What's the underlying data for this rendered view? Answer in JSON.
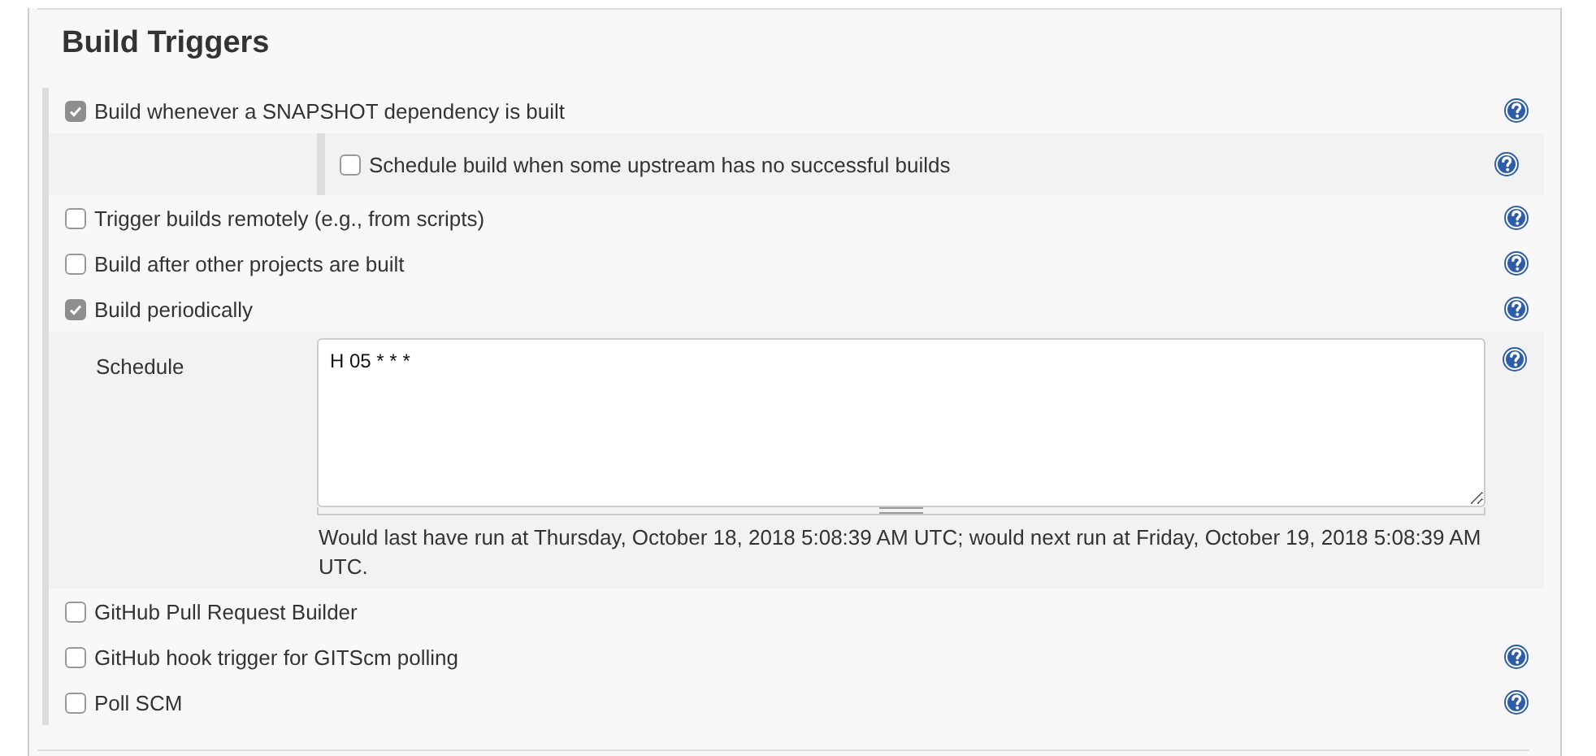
{
  "section": {
    "title": "Build Triggers"
  },
  "triggers": [
    {
      "label": "Build whenever a SNAPSHOT dependency is built",
      "checked": true,
      "help": true,
      "children": [
        {
          "label": "Schedule build when some upstream has no successful builds",
          "checked": false,
          "help": true
        }
      ]
    },
    {
      "label": "Trigger builds remotely (e.g., from scripts)",
      "checked": false,
      "help": true
    },
    {
      "label": "Build after other projects are built",
      "checked": false,
      "help": true
    },
    {
      "label": "Build periodically",
      "checked": true,
      "help": true,
      "schedule": {
        "label": "Schedule",
        "value": "H 05 * * *",
        "help": true,
        "description": "Would last have run at Thursday, October 18, 2018 5:08:39 AM UTC; would next run at Friday, October 19, 2018 5:08:39 AM UTC."
      }
    },
    {
      "label": "GitHub Pull Request Builder",
      "checked": false,
      "help": false
    },
    {
      "label": "GitHub hook trigger for GITScm polling",
      "checked": false,
      "help": true
    },
    {
      "label": "Poll SCM",
      "checked": false,
      "help": true
    }
  ]
}
